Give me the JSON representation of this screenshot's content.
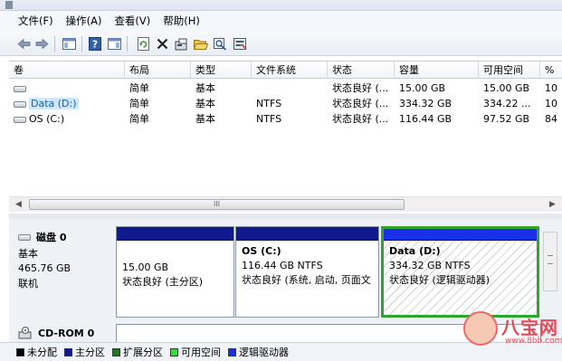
{
  "menubar": {
    "items": [
      "文件(F)",
      "操作(A)",
      "查看(V)",
      "帮助(H)"
    ]
  },
  "toolbar": {
    "icons": [
      "back-arrow-icon",
      "forward-arrow-icon",
      "show-hide-console-tree-icon",
      "help-icon",
      "action-pane-icon",
      "refresh-icon",
      "delete-icon",
      "properties-icon",
      "open-folder-icon",
      "search-icon",
      "explore-icon"
    ]
  },
  "volume_list": {
    "columns": [
      "卷",
      "布局",
      "类型",
      "文件系统",
      "状态",
      "容量",
      "可用空间",
      "%"
    ],
    "rows": [
      {
        "name": "",
        "layout": "简单",
        "type": "基本",
        "fs": "",
        "status": "状态良好 (...",
        "capacity": "15.00 GB",
        "free": "15.00 GB",
        "pct": "10"
      },
      {
        "name": "Data (D:)",
        "layout": "简单",
        "type": "基本",
        "fs": "NTFS",
        "status": "状态良好 (...",
        "capacity": "334.32 GB",
        "free": "334.22 ...",
        "pct": "10"
      },
      {
        "name": "OS (C:)",
        "layout": "简单",
        "type": "基本",
        "fs": "NTFS",
        "status": "状态良好 (...",
        "capacity": "116.44 GB",
        "free": "97.52 GB",
        "pct": "84"
      }
    ],
    "scroll_thumb_label": "III"
  },
  "disk0": {
    "title": "磁盘 0",
    "type": "基本",
    "size": "465.76 GB",
    "state": "联机"
  },
  "partitions": [
    {
      "title": "",
      "line1": "15.00 GB",
      "line2": "状态良好 (主分区)"
    },
    {
      "title": "OS  (C:)",
      "line1": "116.44 GB NTFS",
      "line2": "状态良好 (系统, 启动, 页面文"
    },
    {
      "title": "Data  (D:)",
      "line1": "334.32 GB NTFS",
      "line2": "状态良好 (逻辑驱动器)"
    }
  ],
  "cdrom": {
    "title": "CD-ROM 0"
  },
  "legend": [
    {
      "label": "未分配",
      "color": "#000000"
    },
    {
      "label": "主分区",
      "color": "#111a8c"
    },
    {
      "label": "扩展分区",
      "color": "#1f7a1f"
    },
    {
      "label": "可用空间",
      "color": "#33dd33"
    },
    {
      "label": "逻辑驱动器",
      "color": "#1a2fe8"
    }
  ],
  "watermark": {
    "text": "八宝网",
    "url": "www.8bb.com"
  }
}
